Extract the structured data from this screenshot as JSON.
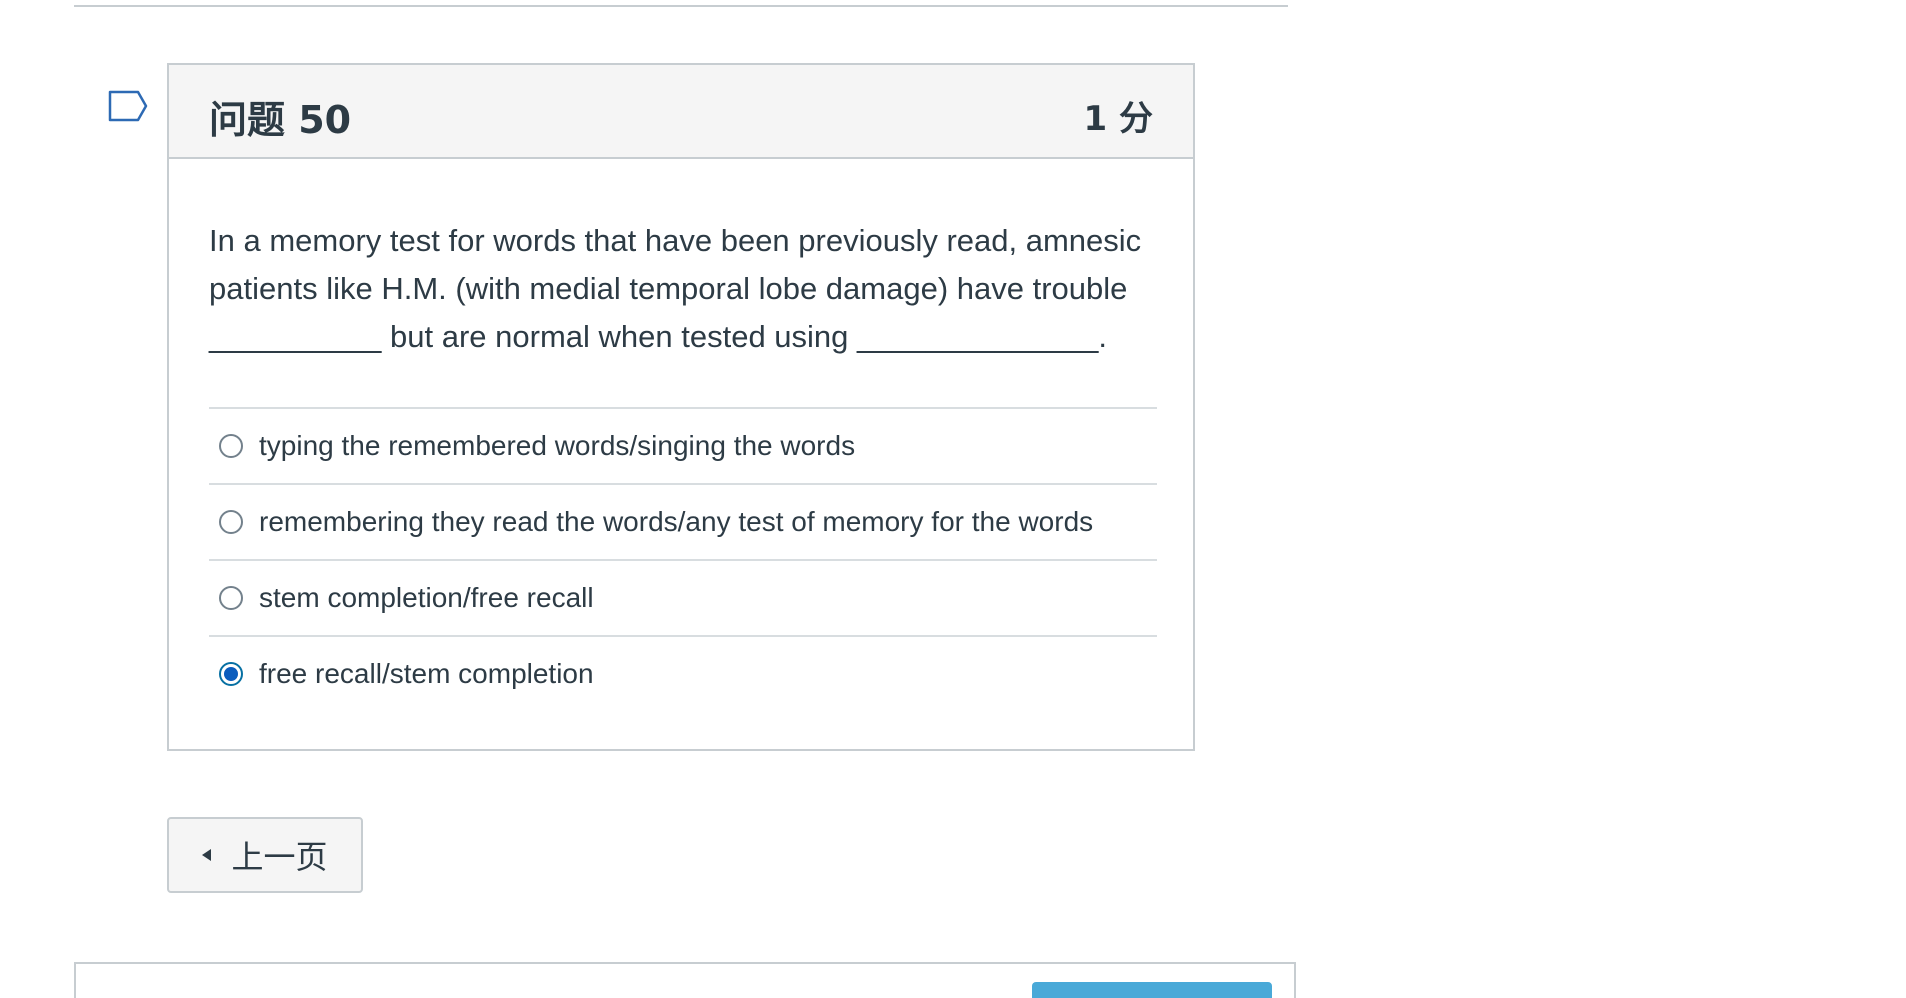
{
  "question": {
    "title": "问题 50",
    "points": "1 分",
    "text": "In a memory test for words that have been previously read, amnesic patients like H.M. (with medial temporal lobe damage) have trouble __________ but are normal when tested using ______________.",
    "answers": [
      {
        "label": "typing the remembered words/singing the words",
        "selected": false
      },
      {
        "label": "remembering they read the words/any test of memory for the words",
        "selected": false
      },
      {
        "label": "stem completion/free recall",
        "selected": false
      },
      {
        "label": "free recall/stem completion",
        "selected": true
      }
    ]
  },
  "navigation": {
    "previous_label": "上一页"
  },
  "colors": {
    "selected_radio": "#0b5cbd",
    "submit_button": "#49a9d8",
    "border": "#c7cdd1"
  }
}
